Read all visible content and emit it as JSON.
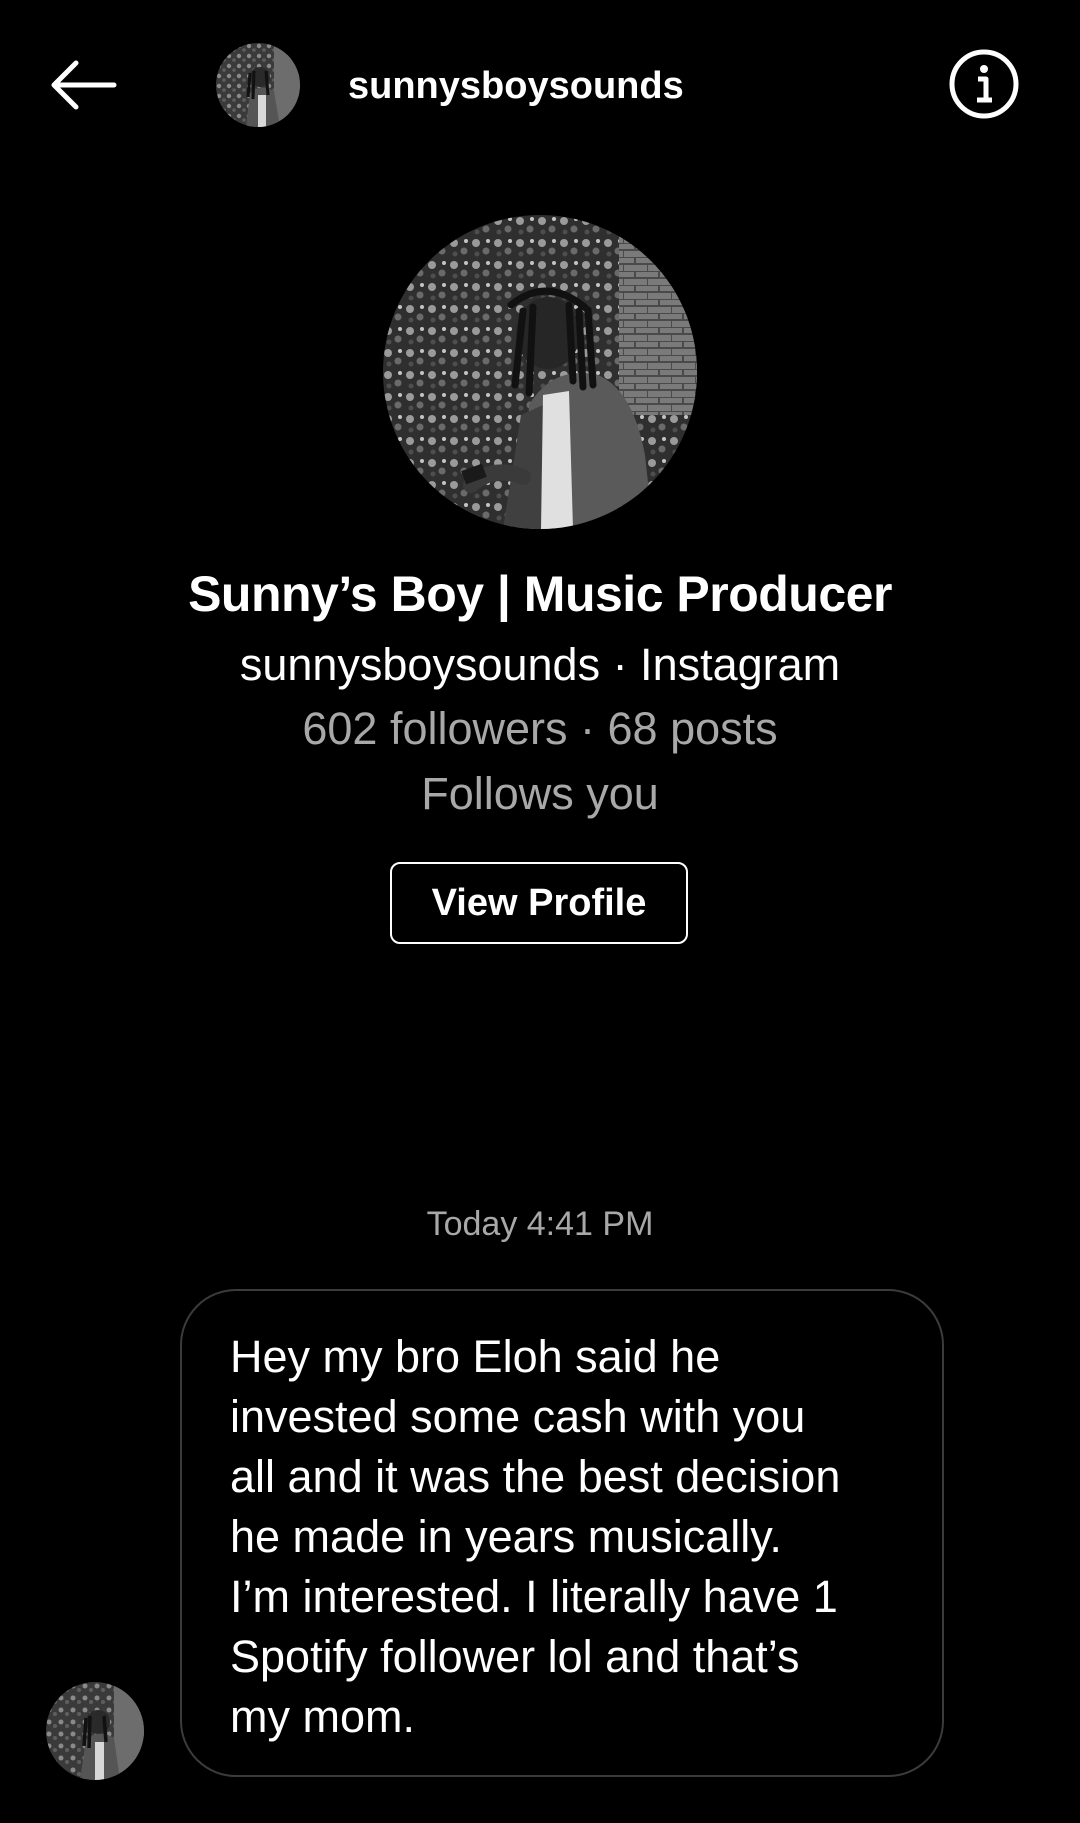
{
  "header": {
    "username": "sunnysboysounds",
    "back_icon": "arrow-left-icon",
    "info_icon": "info-circle-icon"
  },
  "profile": {
    "display_name": "Sunny’s Boy | Music Producer",
    "subtitle": "sunnysboysounds · Instagram",
    "stats": "602 followers · 68 posts",
    "follows_you": "Follows you",
    "view_profile_label": "View Profile"
  },
  "conversation": {
    "timestamp": "Today 4:41 PM",
    "messages": [
      {
        "text": "Hey my bro Eloh said he\ninvested some cash with you\nall and it was the best decision\nhe made in years musically.\nI’m interested. I literally have 1\nSpotify follower lol and that’s\nmy mom."
      }
    ]
  },
  "colors": {
    "background": "#000000",
    "primary_text": "#ffffff",
    "secondary_text": "#a8a8a8",
    "bubble_border": "#3b3b3b"
  }
}
